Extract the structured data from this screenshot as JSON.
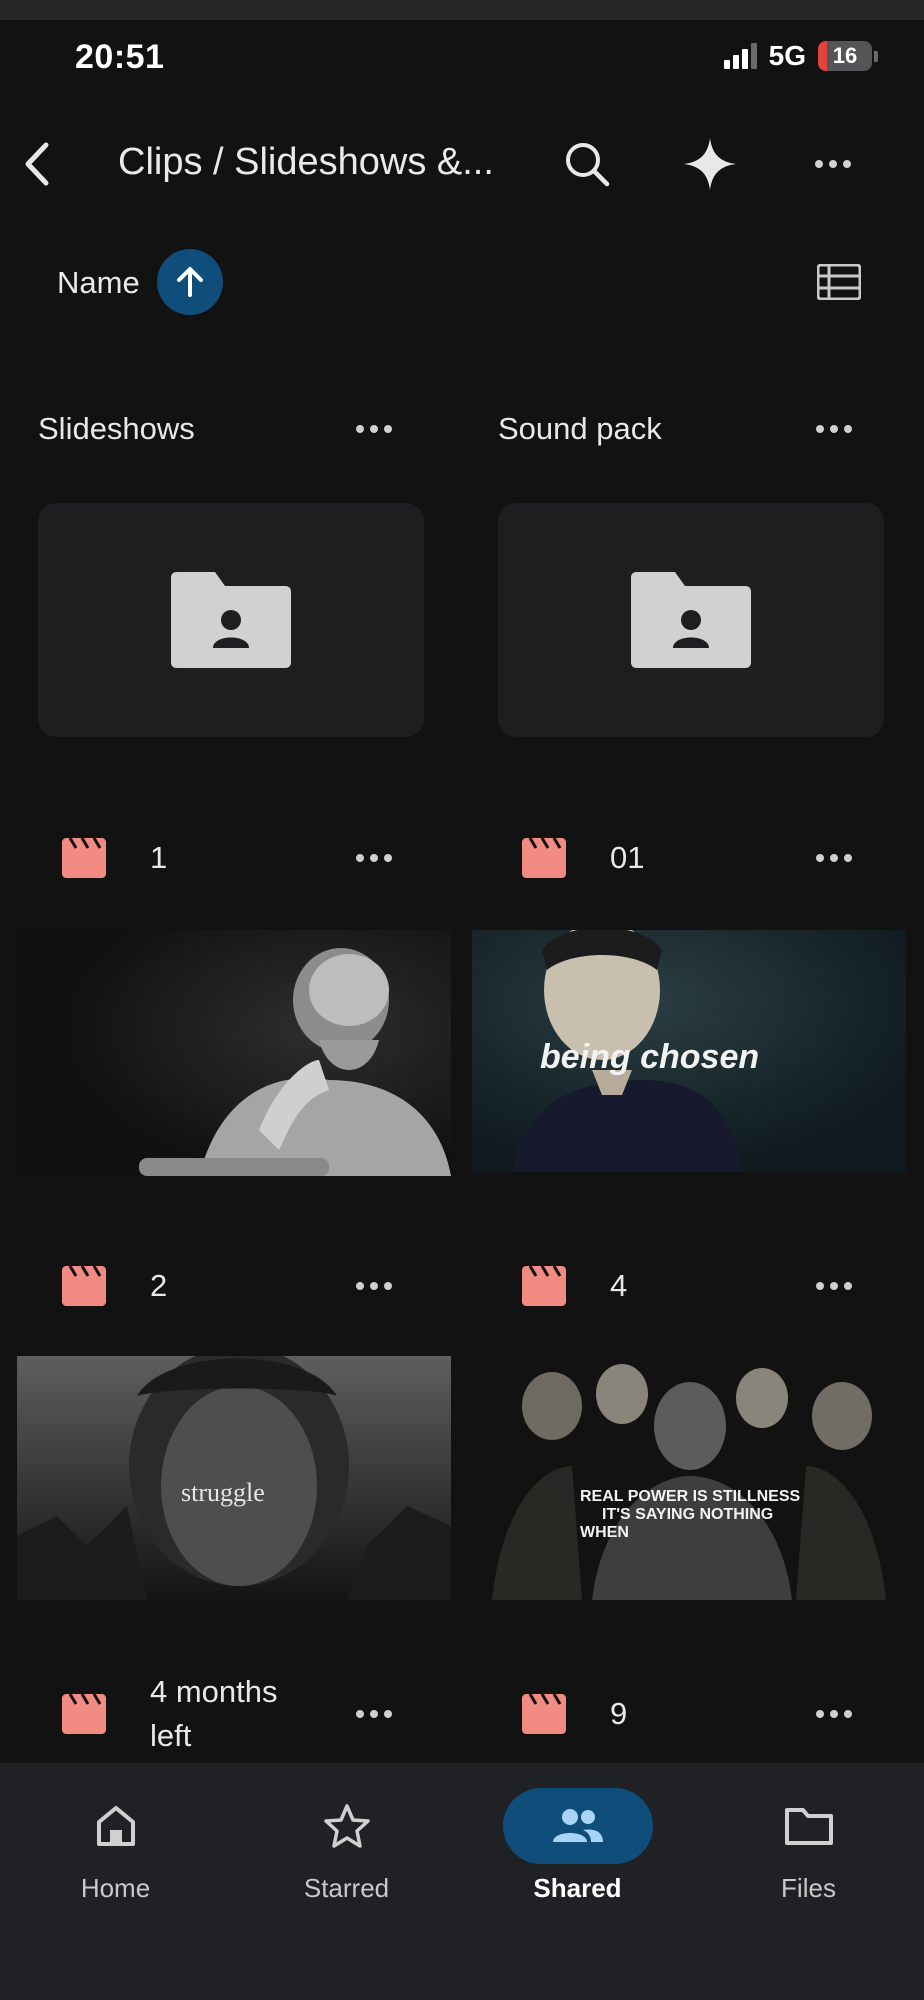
{
  "status_bar": {
    "time": "20:51",
    "network": "5G",
    "battery": "16",
    "battery_level": 0.16
  },
  "app_bar": {
    "title": "Clips / Slideshows &..."
  },
  "sort": {
    "label": "Name",
    "direction": "ascending"
  },
  "folders": [
    {
      "name": "Slideshows",
      "icon": "shared-folder-icon"
    },
    {
      "name": "Sound pack",
      "icon": "shared-folder-icon"
    }
  ],
  "clips": [
    {
      "name": "1",
      "icon": "video-clip-icon",
      "thumb_text": ""
    },
    {
      "name": "01",
      "icon": "video-clip-icon",
      "thumb_text": "being chosen"
    },
    {
      "name": "2",
      "icon": "video-clip-icon",
      "thumb_text": "struggle"
    },
    {
      "name": "4",
      "icon": "video-clip-icon",
      "thumb_text_lines": [
        "REAL POWER IS STILLNESS",
        "IT'S SAYING NOTHING",
        "WHEN"
      ]
    },
    {
      "name_lines": [
        "4 months",
        "left"
      ],
      "icon": "video-clip-icon"
    },
    {
      "name": "9",
      "icon": "video-clip-icon"
    }
  ],
  "bottom_nav": [
    {
      "label": "Home",
      "icon": "home-icon",
      "active": false
    },
    {
      "label": "Starred",
      "icon": "star-icon",
      "active": false
    },
    {
      "label": "Shared",
      "icon": "people-icon",
      "active": true
    },
    {
      "label": "Files",
      "icon": "folder-icon",
      "active": false
    }
  ],
  "colors": {
    "background": "#121213",
    "accent": "#0f4d7a",
    "clip_icon": "#f28b82",
    "nav_bg": "#202124"
  }
}
